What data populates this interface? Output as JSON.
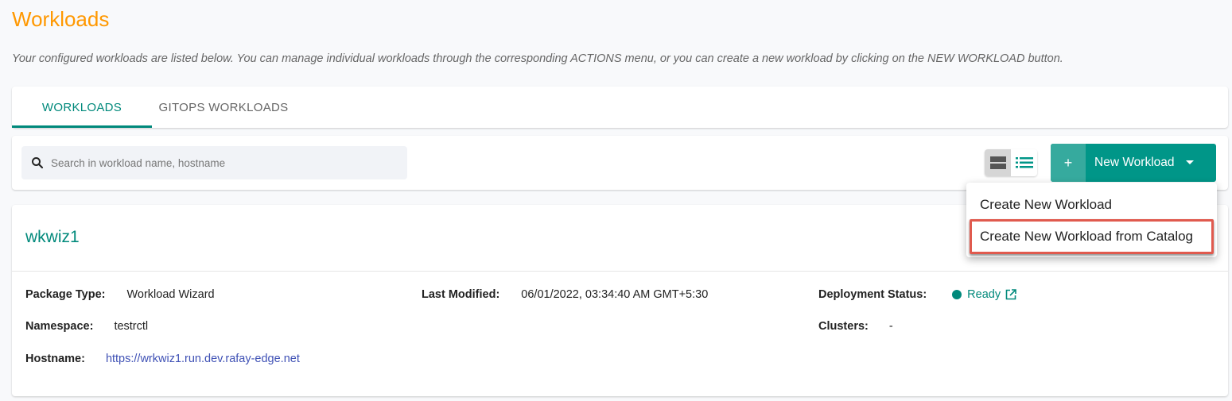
{
  "page": {
    "title": "Workloads",
    "description": "Your configured workloads are listed below. You can manage individual workloads through the corresponding ACTIONS menu, or you can create a new workload by clicking on the NEW WORKLOAD button."
  },
  "tabs": [
    {
      "label": "WORKLOADS",
      "active": true
    },
    {
      "label": "GITOPS WORKLOADS",
      "active": false
    }
  ],
  "toolbar": {
    "search_placeholder": "Search in workload name, hostname",
    "search_value": "",
    "view_modes": [
      "card-view-icon",
      "list-view-icon"
    ],
    "active_view": "card",
    "new_button_plus": "+",
    "new_button_label": "New Workload"
  },
  "dropdown": {
    "items": [
      {
        "label": "Create New Workload"
      },
      {
        "label": "Create New Workload from Catalog",
        "highlighted": true
      }
    ]
  },
  "workload": {
    "name": "wkwiz1",
    "package_type_label": "Package Type:",
    "package_type": "Workload Wizard",
    "namespace_label": "Namespace:",
    "namespace": "testrctl",
    "hostname_label": "Hostname:",
    "hostname": "https://wrkwiz1.run.dev.rafay-edge.net",
    "last_modified_label": "Last Modified:",
    "last_modified": "06/01/2022, 03:34:40 AM GMT+5:30",
    "deployment_status_label": "Deployment Status:",
    "deployment_status": "Ready",
    "clusters_label": "Clusters:",
    "clusters": "-"
  },
  "colors": {
    "title": "#ff9800",
    "accent": "#00897b",
    "link": "#3f51b5",
    "highlight": "#e05a4e"
  }
}
